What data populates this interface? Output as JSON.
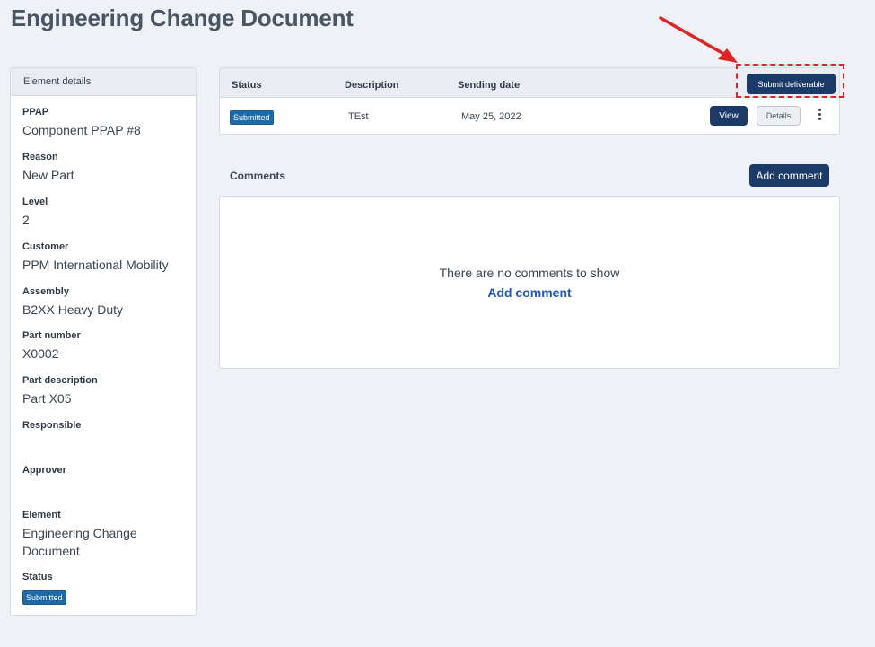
{
  "page": {
    "title": "Engineering Change Document"
  },
  "element_details": {
    "header": "Element details",
    "fields": [
      {
        "label": "PPAP",
        "value": "Component PPAP #8"
      },
      {
        "label": "Reason",
        "value": "New Part"
      },
      {
        "label": "Level",
        "value": "2"
      },
      {
        "label": "Customer",
        "value": "PPM International Mobility"
      },
      {
        "label": "Assembly",
        "value": "B2XX Heavy Duty"
      },
      {
        "label": "Part number",
        "value": "X0002"
      },
      {
        "label": "Part description",
        "value": "Part X05"
      },
      {
        "label": "Responsible",
        "value": ""
      },
      {
        "label": "Approver",
        "value": ""
      },
      {
        "label": "Element",
        "value": "Engineering Change Document"
      },
      {
        "label": "Status",
        "badge": "Submitted"
      }
    ]
  },
  "deliverables": {
    "columns": [
      "Status",
      "Description",
      "Sending date"
    ],
    "submit_label": "Submit deliverable",
    "rows": [
      {
        "status": "Submitted",
        "description": "TEst",
        "sending_date": "May 25, 2022",
        "view_label": "View",
        "details_label": "Details"
      }
    ]
  },
  "comments": {
    "title": "Comments",
    "add_label": "Add comment",
    "empty_text": "There are no comments to show",
    "empty_link": "Add comment"
  },
  "colors": {
    "primary": "#1b3a68",
    "badge": "#1e6aa8",
    "link": "#1f55c7",
    "annotation": "#e02424",
    "background": "#eef1f6"
  },
  "icons": {
    "row_menu": "kebab-menu-icon",
    "annotation": "red-arrow-icon"
  }
}
